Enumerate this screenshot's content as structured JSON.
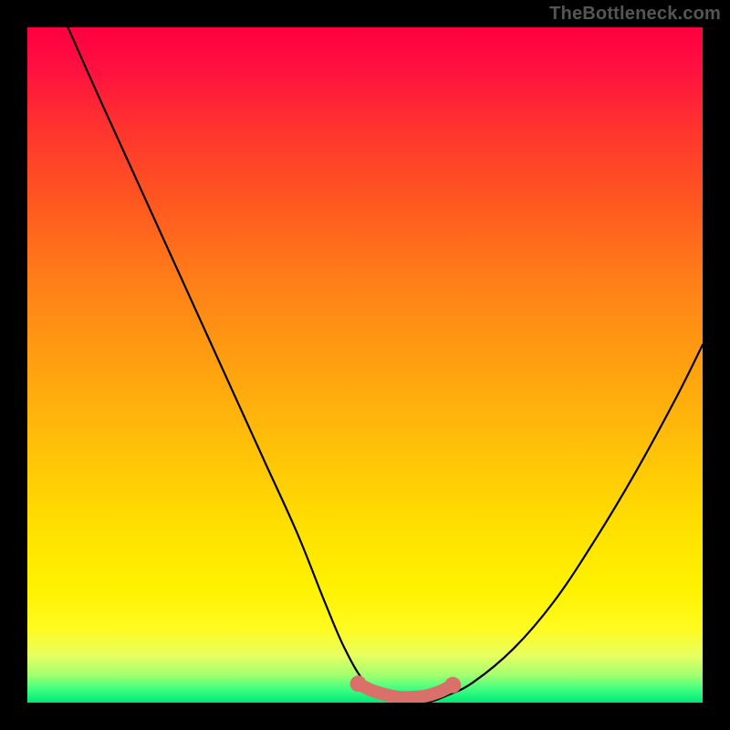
{
  "watermark": "TheBottleneck.com",
  "chart_data": {
    "type": "line",
    "title": "",
    "xlabel": "",
    "ylabel": "",
    "xlim": [
      0,
      100
    ],
    "ylim": [
      0,
      100
    ],
    "series": [
      {
        "name": "bottleneck-curve",
        "x": [
          6,
          10,
          15,
          20,
          25,
          30,
          35,
          40,
          44,
          47,
          50,
          53,
          56,
          59,
          62,
          66,
          72,
          78,
          84,
          90,
          96,
          100
        ],
        "values": [
          100,
          91,
          80,
          69,
          58,
          47,
          36,
          25,
          15,
          8,
          3,
          1,
          0,
          0,
          1,
          3,
          8,
          15,
          24,
          34,
          45,
          53
        ]
      },
      {
        "name": "highlight-band",
        "x": [
          49,
          51,
          53,
          55,
          57,
          59,
          61,
          63
        ],
        "values": [
          2.8,
          1.8,
          1.2,
          0.8,
          0.8,
          1.0,
          1.6,
          2.6
        ]
      }
    ],
    "colors": {
      "curve": "#000000",
      "highlight": "#d9706a"
    }
  }
}
